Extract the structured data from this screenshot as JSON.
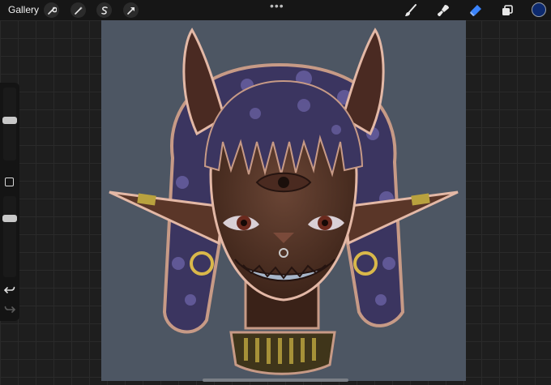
{
  "toolbar": {
    "gallery_label": "Gallery",
    "left_tools": [
      "wrench-icon",
      "magic-wand-icon",
      "selection-icon",
      "transform-arrow-icon"
    ],
    "more_dots": "•••",
    "right_tools": [
      "brush-icon",
      "smudge-icon",
      "eraser-icon",
      "layers-icon"
    ],
    "active_tool": "eraser",
    "accent_color": "#3a84ff",
    "current_color": "#0d2a6e"
  },
  "sidebar": {
    "size_slider_level": 0.55,
    "opacity_slider_level": 0.75,
    "undo_icon": "undo-icon",
    "redo_icon": "redo-icon"
  },
  "canvas": {
    "background_color": "#4d5663",
    "artwork": "horned-cyclops-character-illustration"
  }
}
